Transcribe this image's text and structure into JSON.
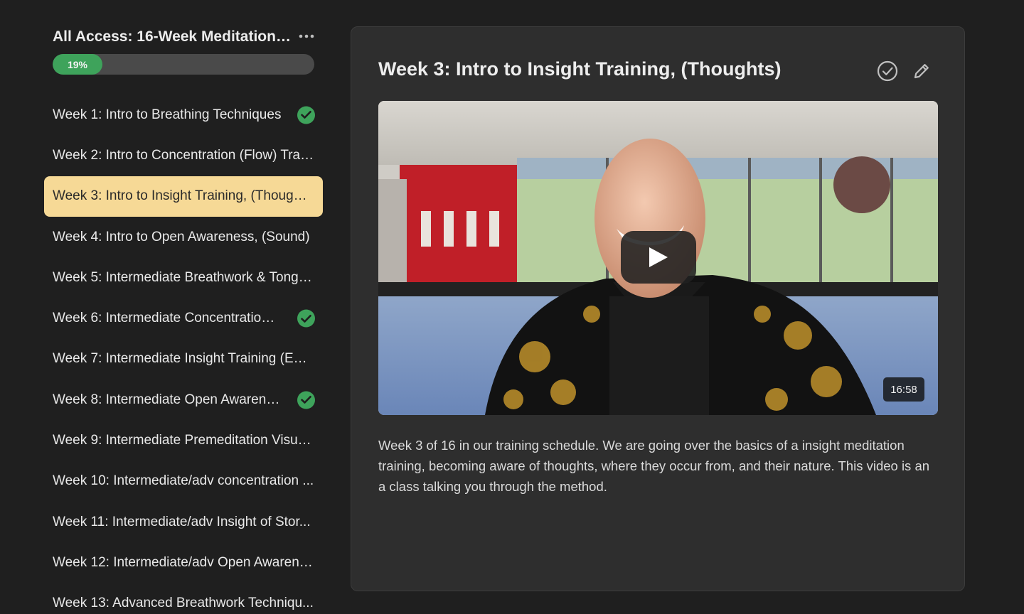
{
  "course": {
    "title": "All Access: 16-Week Meditation ...",
    "progress_percent": 19,
    "progress_label": "19%",
    "more_icon": "more-horizontal-icon"
  },
  "lessons": [
    {
      "label": "Week 1: Intro to Breathing Techniques",
      "completed": true,
      "active": false
    },
    {
      "label": "Week 2: Intro to Concentration (Flow) Trai...",
      "completed": false,
      "active": false
    },
    {
      "label": "Week 3: Intro to Insight Training, (Thought...",
      "completed": false,
      "active": true
    },
    {
      "label": "Week 4: Intro to Open Awareness, (Sound)",
      "completed": false,
      "active": false
    },
    {
      "label": "Week 5: Intermediate Breathwork & Tonglen",
      "completed": false,
      "active": false
    },
    {
      "label": "Week 6: Intermediate Concentration ...",
      "completed": true,
      "active": false
    },
    {
      "label": "Week 7: Intermediate Insight Training (Em...",
      "completed": false,
      "active": false
    },
    {
      "label": "Week 8: Intermediate Open Awarene...",
      "completed": true,
      "active": false
    },
    {
      "label": "Week 9: Intermediate Premeditation Visua...",
      "completed": false,
      "active": false
    },
    {
      "label": "Week 10: Intermediate/adv concentration ...",
      "completed": false,
      "active": false
    },
    {
      "label": "Week 11: Intermediate/adv Insight of Stor...",
      "completed": false,
      "active": false
    },
    {
      "label": "Week 12: Intermediate/adv Open Awarene...",
      "completed": false,
      "active": false
    },
    {
      "label": "Week 13: Advanced Breathwork Techniqu...",
      "completed": false,
      "active": false
    }
  ],
  "main": {
    "title": "Week 3: Intro to Insight Training, (Thoughts)",
    "complete_icon": "check-circle-icon",
    "edit_icon": "pencil-icon",
    "video": {
      "duration": "16:58",
      "play_icon": "play-icon"
    },
    "description": "Week 3 of 16 in our training schedule. We are going over the basics of a insight meditation training, becoming aware of thoughts, where they occur from, and their nature. This video is an a class talking you through the method."
  },
  "colors": {
    "accent_green": "#3ea35b",
    "active_highlight": "#f6d996",
    "background": "#1f1f1f",
    "panel": "#2e2e2e"
  }
}
